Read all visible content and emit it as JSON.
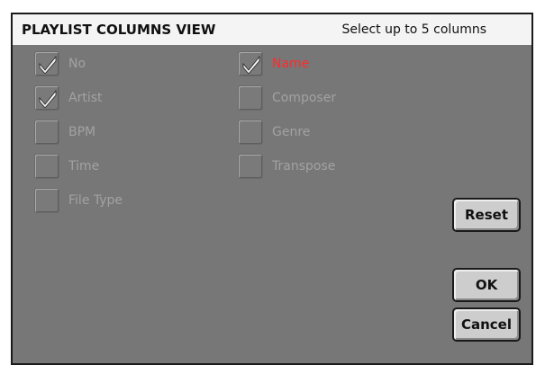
{
  "dialog": {
    "title": "PLAYLIST COLUMNS VIEW",
    "hint": "Select up to 5 columns"
  },
  "columns_left": [
    {
      "label": "No",
      "checked": true,
      "active": false
    },
    {
      "label": "Artist",
      "checked": true,
      "active": false
    },
    {
      "label": "BPM",
      "checked": false,
      "active": false
    },
    {
      "label": "Time",
      "checked": false,
      "active": false
    },
    {
      "label": "File Type",
      "checked": false,
      "active": false
    }
  ],
  "columns_right": [
    {
      "label": "Name",
      "checked": true,
      "active": true
    },
    {
      "label": "Composer",
      "checked": false,
      "active": false
    },
    {
      "label": "Genre",
      "checked": false,
      "active": false
    },
    {
      "label": "Transpose",
      "checked": false,
      "active": false
    }
  ],
  "buttons": {
    "reset": "Reset",
    "ok": "OK",
    "cancel": "Cancel"
  },
  "colors": {
    "dialog_bg": "#777777",
    "header_bg": "#f4f4f4",
    "label_inactive": "#a2a2a2",
    "label_active": "#ff2b2b",
    "check_mark": "#f0f0f0"
  }
}
